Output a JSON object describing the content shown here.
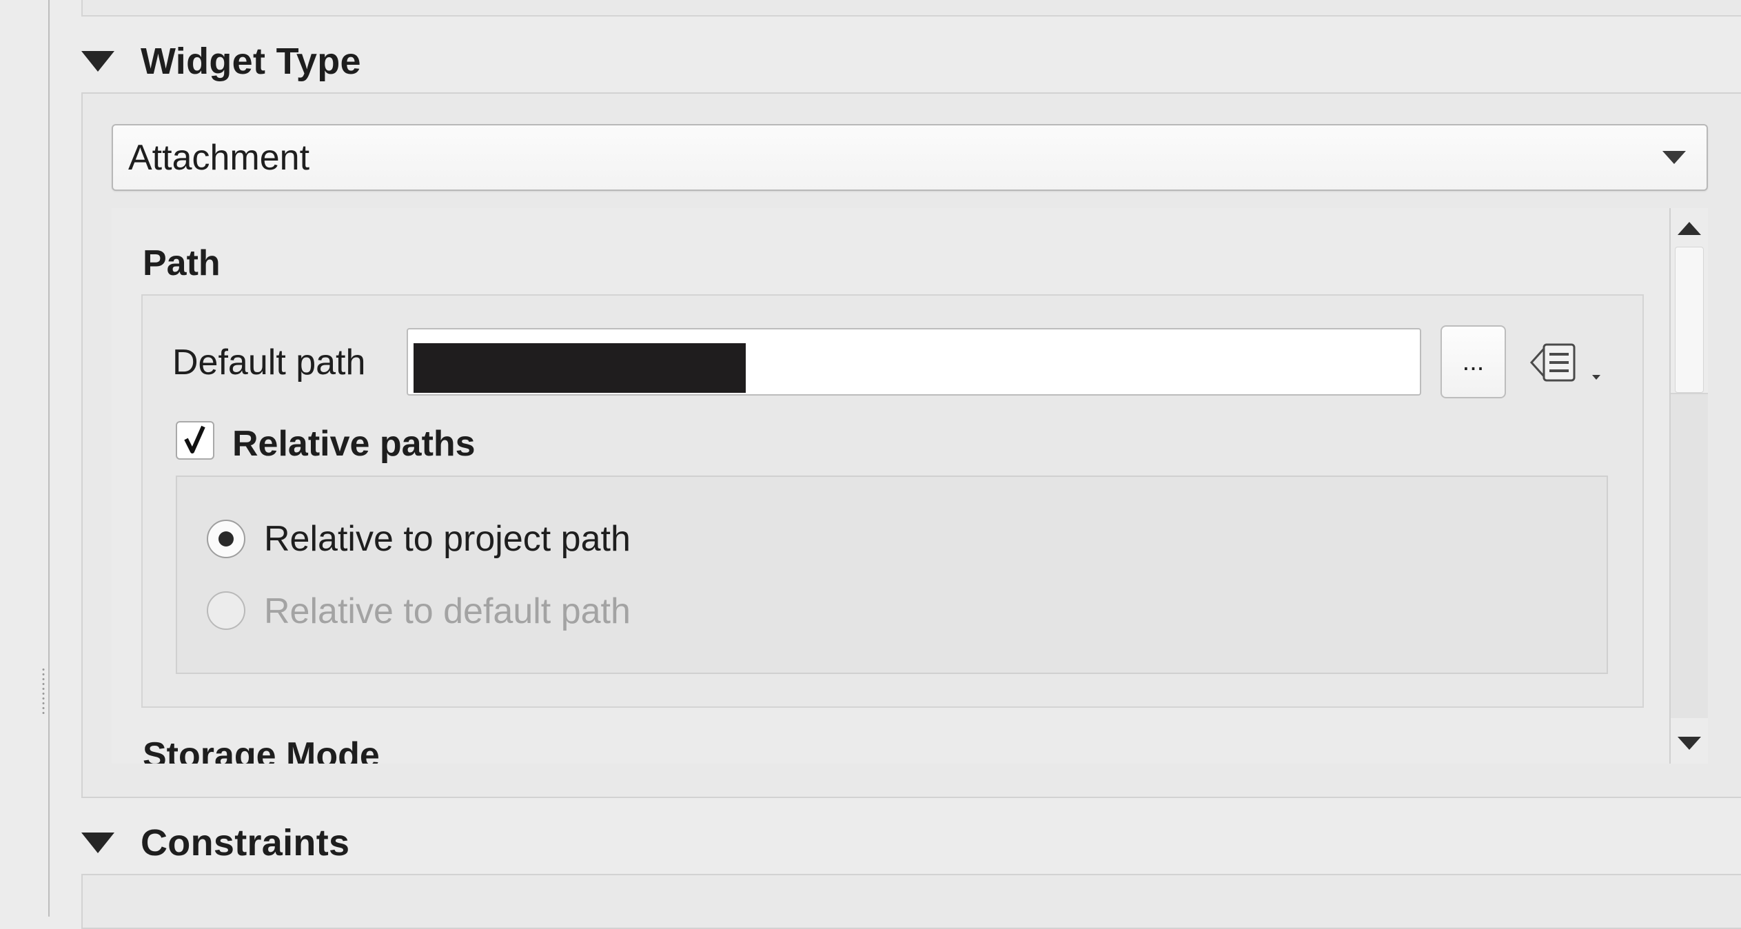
{
  "widget_type": {
    "title": "Widget Type",
    "selected": "Attachment"
  },
  "path_section": {
    "title": "Path",
    "default_path_label": "Default path",
    "browse_label": "...",
    "relative_paths_label": "Relative paths",
    "relative_paths_checked": true,
    "radio_options": [
      {
        "label": "Relative to project path",
        "checked": true,
        "enabled": true
      },
      {
        "label": "Relative to default path",
        "checked": false,
        "enabled": false
      }
    ]
  },
  "storage_mode": {
    "title": "Storage Mode"
  },
  "constraints": {
    "title": "Constraints"
  },
  "icons": {
    "section_toggle": "triangle-down-icon",
    "combo_caret": "chevron-down-icon",
    "expression": "data-defined-override-icon",
    "scroll_up": "scroll-up-arrow-icon",
    "scroll_down": "scroll-down-arrow-icon"
  }
}
